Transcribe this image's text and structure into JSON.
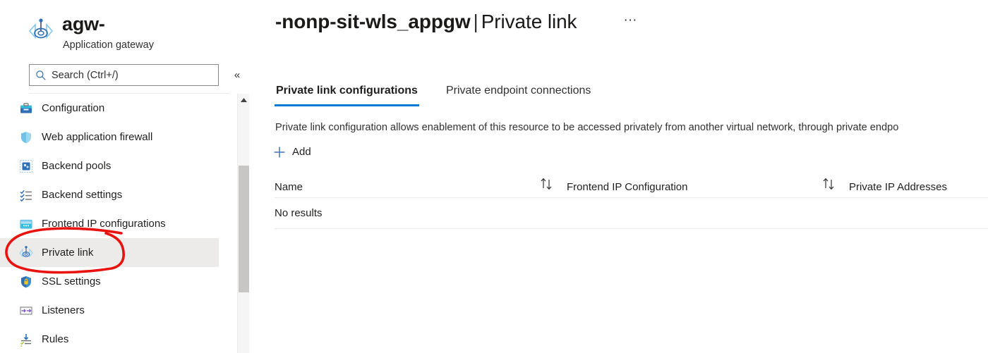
{
  "resource": {
    "icon": "application-gateway-icon",
    "name": "agw-",
    "type": "Application gateway"
  },
  "search": {
    "placeholder": "Search (Ctrl+/)",
    "value": "",
    "icon": "search-icon",
    "collapse_label": "«"
  },
  "sidebar": {
    "items": [
      {
        "label": "Configuration",
        "icon": "configuration-icon",
        "selected": false
      },
      {
        "label": "Web application firewall",
        "icon": "shield-icon",
        "selected": false
      },
      {
        "label": "Backend pools",
        "icon": "backend-pools-icon",
        "selected": false
      },
      {
        "label": "Backend settings",
        "icon": "checklist-icon",
        "selected": false
      },
      {
        "label": "Frontend IP configurations",
        "icon": "frontend-ip-icon",
        "selected": false
      },
      {
        "label": "Private link",
        "icon": "private-link-icon",
        "selected": true
      },
      {
        "label": "SSL settings",
        "icon": "lock-shield-icon",
        "selected": false
      },
      {
        "label": "Listeners",
        "icon": "listeners-icon",
        "selected": false
      },
      {
        "label": "Rules",
        "icon": "rules-icon",
        "selected": false
      }
    ]
  },
  "header": {
    "resource_name": "-nonp-sit-wls_appgw",
    "separator": "|",
    "blade": "Private link",
    "more_label": "···"
  },
  "tabs": [
    {
      "label": "Private link configurations",
      "active": true
    },
    {
      "label": "Private endpoint connections",
      "active": false
    }
  ],
  "content": {
    "description": "Private link configuration allows enablement of this resource to be accessed privately from another virtual network, through private endpo",
    "add_label": "Add",
    "add_icon": "plus-icon",
    "empty_text": "No results"
  },
  "table": {
    "columns": [
      {
        "label": "Name",
        "sortable": true
      },
      {
        "label": "Frontend IP Configuration",
        "sortable": true
      },
      {
        "label": "Private IP Addresses",
        "sortable": false
      }
    ],
    "sort_icon": "sort-updown-icon",
    "rows": []
  },
  "annotation": {
    "shape": "red-ellipse-highlight",
    "target": "Private link",
    "color": "#e8120e"
  },
  "colors": {
    "accent": "#0078d4",
    "selected_row": "#edebe9",
    "annotation": "#e8120e"
  }
}
